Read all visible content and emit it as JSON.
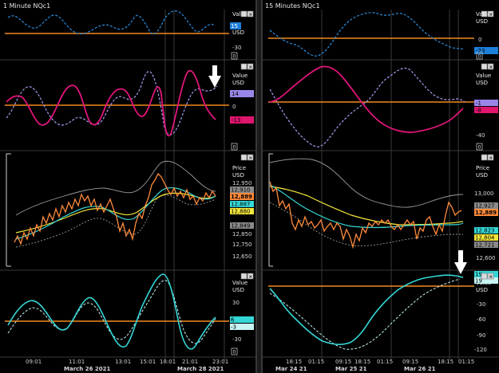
{
  "left_window": {
    "title": "1 Minute NQc1",
    "panels": {
      "p1": {
        "axis_header": [
          "Value",
          "USD"
        ],
        "ticks": [
          "-30"
        ],
        "zero_box": "0",
        "badge": {
          "text": "15",
          "color": "#1e7fd8",
          "text_color": "#ffffff"
        }
      },
      "p2": {
        "axis_header": [
          "Value",
          "USD"
        ],
        "ticks": [
          "0"
        ],
        "zero_box": "0",
        "badges": [
          {
            "text": "14",
            "color": "#9a86e8",
            "text_color": "#000000"
          },
          {
            "text": "-13",
            "color": "#e0156e",
            "text_color": "#000000"
          }
        ]
      },
      "p3": {
        "axis_header": [
          "Price",
          "USD"
        ],
        "ticks": [
          "12,950",
          "12,910",
          "12,850",
          "12,750",
          "12,700",
          "12,650"
        ],
        "badges": [
          {
            "text": "12,910",
            "color": "#8a8a8a",
            "text_color": "#000000"
          },
          {
            "text": "12,889",
            "color": "#ff8a3a",
            "text_color": "#000000"
          },
          {
            "text": "12,887",
            "color": "#35d6d6",
            "text_color": "#000000"
          },
          {
            "text": "12,880",
            "color": "#f2e63a",
            "text_color": "#000000"
          },
          {
            "text": "12,849",
            "color": "#8a8a8a",
            "text_color": "#000000"
          }
        ]
      },
      "p4": {
        "axis_header": [
          "Value",
          "USD"
        ],
        "ticks": [
          "30",
          "-30"
        ],
        "zero_box": "0",
        "badges": [
          {
            "text": "6",
            "color": "#35d6d6",
            "text_color": "#000000"
          },
          {
            "text": "-3",
            "color": "#c8f4f4",
            "text_color": "#000000"
          }
        ]
      }
    },
    "time_axis": [
      "09:01",
      "11:01",
      "13:01",
      "15:01",
      "18:01",
      "21:01",
      "23:01"
    ],
    "date_labels": [
      "March 26 2021",
      "March 28 2021"
    ]
  },
  "right_window": {
    "title": "15 Minutes NQc1",
    "panels": {
      "p1": {
        "axis_header": [
          "Value",
          "USD"
        ],
        "ticks": [
          "0",
          "-23"
        ],
        "zero_box": "0",
        "badge": {
          "text": "-23",
          "color": "#1e7fd8",
          "text_color": "#000000"
        }
      },
      "p2": {
        "axis_header": [
          "Value",
          "USD"
        ],
        "ticks": [
          "-1",
          "-40"
        ],
        "zero_box": "0",
        "badges": [
          {
            "text": "-1",
            "color": "#9a86e8",
            "text_color": "#000000"
          },
          {
            "text": "-8",
            "color": "#e0156e",
            "text_color": "#000000"
          }
        ]
      },
      "p3": {
        "axis_header": [
          "Price",
          "USD"
        ],
        "ticks": [
          "13,000",
          "12,600"
        ],
        "badges": [
          {
            "text": "12,927",
            "color": "#8a8a8a",
            "text_color": "#000000"
          },
          {
            "text": "12,889",
            "color": "#ff8a3a",
            "text_color": "#000000"
          },
          {
            "text": "12,823",
            "color": "#35d6d6",
            "text_color": "#000000"
          },
          {
            "text": "12,804",
            "color": "#f2e63a",
            "text_color": "#000000"
          },
          {
            "text": "12,721",
            "color": "#8a8a8a",
            "text_color": "#000000"
          }
        ]
      },
      "p4": {
        "axis_header": [
          "Value",
          "USD"
        ],
        "ticks": [
          "-30",
          "-60",
          "-90",
          "-120"
        ],
        "zero_box": "0",
        "badges": [
          {
            "text": "19",
            "color": "#35d6d6",
            "text_color": "#000000"
          },
          {
            "text": "19",
            "color": "#c8f4f4",
            "text_color": "#000000"
          }
        ]
      }
    },
    "time_axis": [
      "18:15",
      "01:15",
      "09:15",
      "18:15",
      "01:15",
      "09:15",
      "18:15",
      "01:15"
    ],
    "date_labels": [
      "Mar 24 21",
      "Mar 25 21",
      "Mar 26 21"
    ]
  },
  "colors": {
    "orange": "#f28a1e",
    "blue_dash": "#2c8fe0",
    "violet_dash": "#a59cf0",
    "magenta": "#e0157a",
    "cyan": "#35d6d6",
    "yellow": "#f2e63a",
    "grey_band": "#9a9a9a",
    "price_line": "#ff8a3a"
  }
}
